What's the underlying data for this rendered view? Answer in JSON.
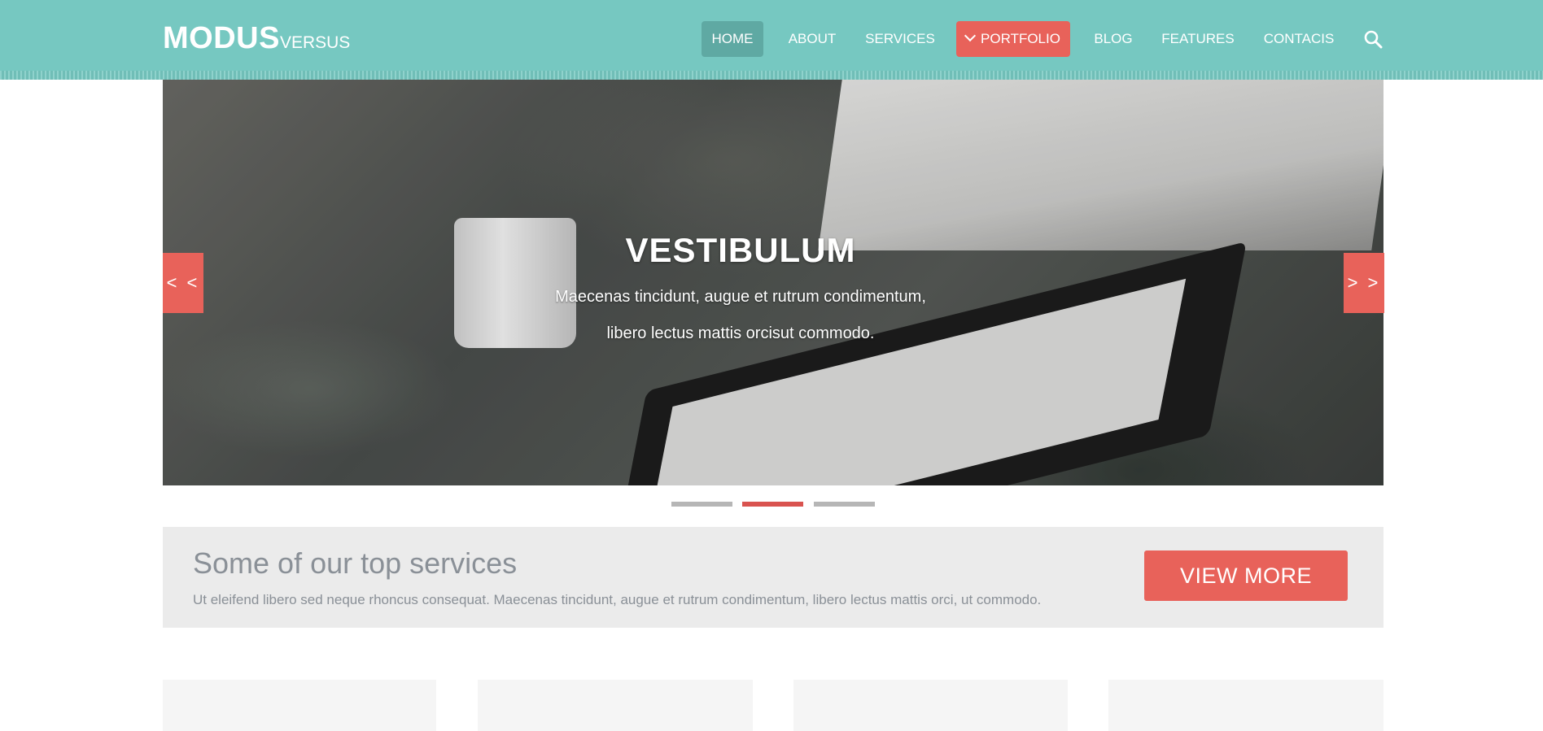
{
  "header": {
    "logo_main": "MODUS",
    "logo_sub": "VERSUS",
    "nav": [
      {
        "label": "HOME",
        "state": "active"
      },
      {
        "label": "ABOUT"
      },
      {
        "label": "SERVICES"
      },
      {
        "label": "PORTFOLIO",
        "state": "highlighted",
        "icon": "chevron-down-icon"
      },
      {
        "label": "BLOG"
      },
      {
        "label": "FEATURES"
      },
      {
        "label": "CONTACIS"
      }
    ],
    "search_icon": "search-icon"
  },
  "slider": {
    "title": "VESTIBULUM",
    "line1": "Maecenas tincidunt, augue et rutrum condimentum,",
    "line2": "libero lectus mattis orcisut commodo.",
    "prev_label": "< <",
    "next_label": "> >",
    "slides_total": 3,
    "active_slide": 2
  },
  "services": {
    "title": "Some of our top services",
    "text": "Ut eleifend libero sed neque rhoncus consequat. Maecenas tincidunt, augue et rutrum condimentum, libero lectus mattis orci, ut commodo.",
    "button_label": "VIEW MORE"
  },
  "colors": {
    "header_bg": "#76c8c1",
    "nav_active_bg": "#5fa9a3",
    "accent": "#e8625a",
    "services_bg": "#ebebeb",
    "muted_text": "#8a9097"
  }
}
